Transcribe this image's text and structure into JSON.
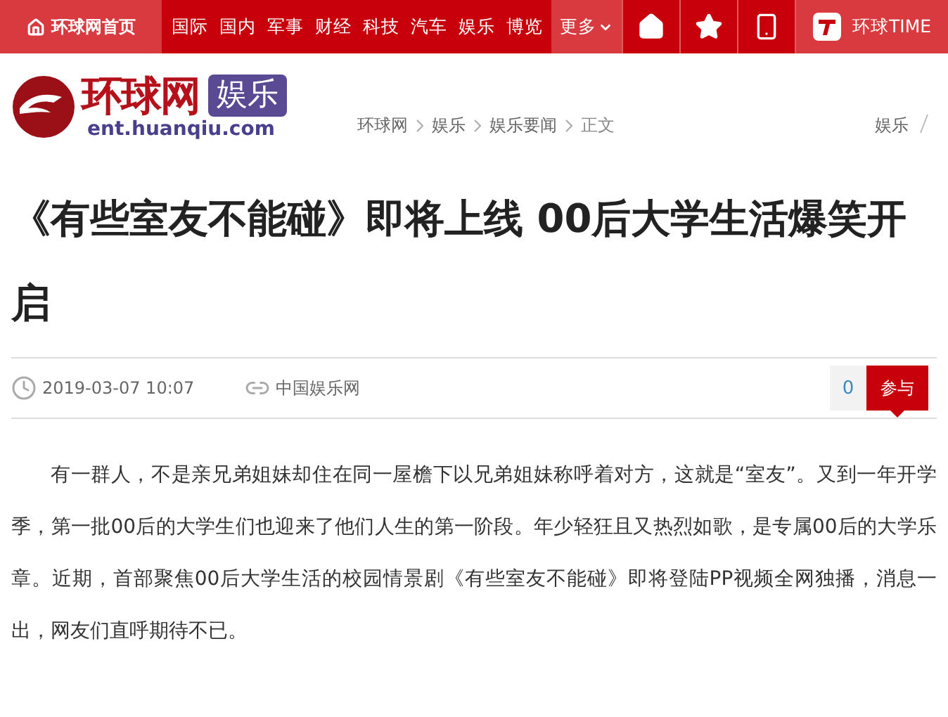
{
  "top_nav": {
    "home_link": "环球网首页",
    "items": [
      "国际",
      "国内",
      "军事",
      "财经",
      "科技",
      "汽车",
      "娱乐",
      "博览"
    ],
    "more": "更多",
    "app_link": "环球TIME"
  },
  "header": {
    "logo_text": "环球网",
    "channel_badge": "娱乐",
    "logo_url": "ent.huanqiu.com",
    "breadcrumb": [
      "环球网",
      "娱乐",
      "娱乐要闻",
      "正文"
    ],
    "side_links": [
      "娱乐"
    ]
  },
  "article": {
    "title": "《有些室友不能碰》即将上线 00后大学生活爆笑开启",
    "date": "2019-03-07 10:07",
    "source": "中国娱乐网",
    "comment_count": "0",
    "join_button": "参与",
    "paragraphs": [
      "有一群人，不是亲兄弟姐妹却住在同一屋檐下以兄弟姐妹称呼着对方，这就是“室友”。又到一年开学季，第一批00后的大学生们也迎来了他们人生的第一阶段。年少轻狂且又热烈如歌，是专属00后的大学乐章。近期，首部聚焦00后大学生活的校园情景剧《有些室友不能碰》即将登陆PP视频全网独播，消息一出，网友们直呼期待不已。"
    ]
  }
}
